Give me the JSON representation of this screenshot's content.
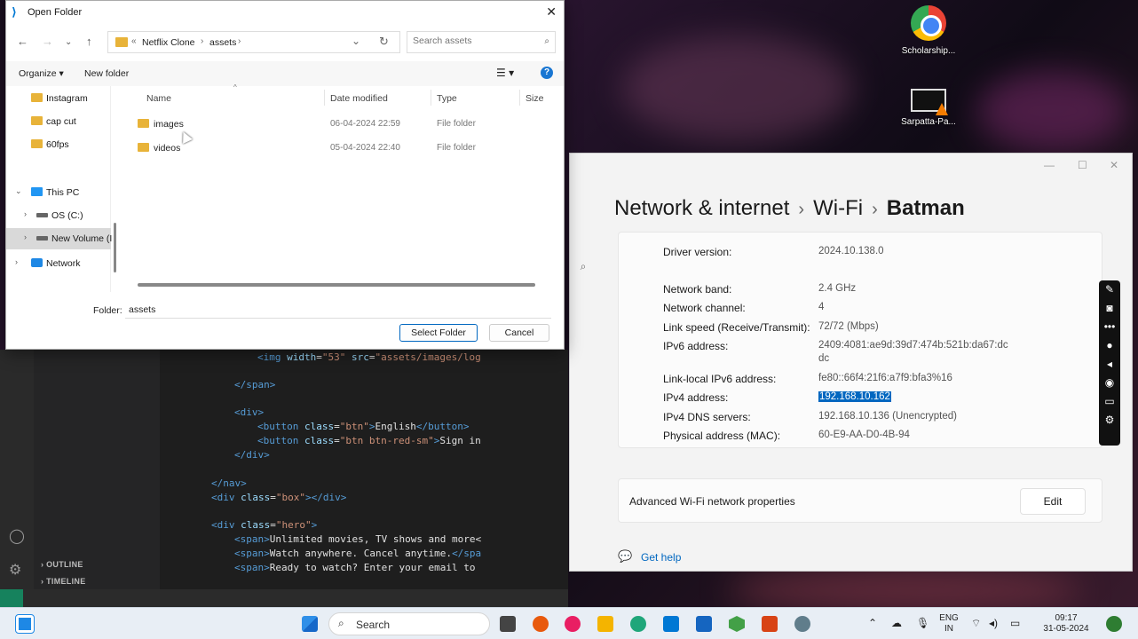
{
  "desktop": {
    "icons": [
      {
        "label": "Scholarship..."
      },
      {
        "label": "Sarpatta-Pa..."
      }
    ]
  },
  "editor": {
    "code_lines": [
      {
        "indent": 4,
        "parts": [
          [
            "tag",
            "<img "
          ],
          [
            "attr",
            "width"
          ],
          [
            "txt",
            "="
          ],
          [
            "str",
            "\"53\""
          ],
          [
            "txt",
            " "
          ],
          [
            "attr",
            "src"
          ],
          [
            "txt",
            "="
          ],
          [
            "str",
            "\"assets/images/log"
          ]
        ]
      },
      {
        "indent": 3,
        "parts": [
          [
            "tag",
            "</span>"
          ]
        ]
      },
      {
        "indent": 3,
        "parts": [
          [
            "tag",
            "<div>"
          ]
        ]
      },
      {
        "indent": 4,
        "parts": [
          [
            "tag",
            "<button "
          ],
          [
            "attr",
            "class"
          ],
          [
            "txt",
            "="
          ],
          [
            "str",
            "\"btn\""
          ],
          [
            "tag",
            ">"
          ],
          [
            "txt",
            "English"
          ],
          [
            "tag",
            "</button>"
          ]
        ]
      },
      {
        "indent": 4,
        "parts": [
          [
            "tag",
            "<button "
          ],
          [
            "attr",
            "class"
          ],
          [
            "txt",
            "="
          ],
          [
            "str",
            "\"btn btn-red-sm\""
          ],
          [
            "tag",
            ">"
          ],
          [
            "txt",
            "Sign in"
          ]
        ]
      },
      {
        "indent": 3,
        "parts": [
          [
            "tag",
            "</div>"
          ]
        ]
      },
      {
        "indent": 2,
        "parts": [
          [
            "tag",
            "</nav>"
          ]
        ]
      },
      {
        "indent": 2,
        "parts": [
          [
            "tag",
            "<div "
          ],
          [
            "attr",
            "class"
          ],
          [
            "txt",
            "="
          ],
          [
            "str",
            "\"box\""
          ],
          [
            "tag",
            "></div>"
          ]
        ]
      },
      {
        "indent": 2,
        "parts": [
          [
            "tag",
            "<div "
          ],
          [
            "attr",
            "class"
          ],
          [
            "txt",
            "="
          ],
          [
            "str",
            "\"hero\""
          ],
          [
            "tag",
            ">"
          ]
        ]
      },
      {
        "indent": 3,
        "parts": [
          [
            "tag",
            "<span>"
          ],
          [
            "txt",
            "Unlimited movies, TV shows and more<"
          ]
        ]
      },
      {
        "indent": 3,
        "parts": [
          [
            "tag",
            "<span>"
          ],
          [
            "txt",
            "Watch anywhere. Cancel anytime."
          ],
          [
            "tag",
            "</spa"
          ]
        ]
      },
      {
        "indent": 3,
        "parts": [
          [
            "tag",
            "<span>"
          ],
          [
            "txt",
            "Ready to watch? Enter your email to"
          ]
        ]
      }
    ],
    "outline_label": "OUTLINE",
    "timeline_label": "TIMELINE"
  },
  "dialog": {
    "title": "Open Folder",
    "breadcrumb": [
      "Netflix Clone",
      "assets"
    ],
    "search_placeholder": "Search assets",
    "organize_label": "Organize ▾",
    "new_folder_label": "New folder",
    "nav_items": [
      {
        "label": "Instagram",
        "kind": "folder"
      },
      {
        "label": "cap cut",
        "kind": "folder"
      },
      {
        "label": "60fps",
        "kind": "folder"
      },
      {
        "label": "This PC",
        "kind": "pc"
      },
      {
        "label": "OS (C:)",
        "kind": "drive"
      },
      {
        "label": "New Volume (I",
        "kind": "drive"
      },
      {
        "label": "Network",
        "kind": "network"
      }
    ],
    "columns": {
      "name": "Name",
      "date": "Date modified",
      "type": "Type",
      "size": "Size"
    },
    "files": [
      {
        "name": "images",
        "date": "06-04-2024 22:59",
        "type": "File folder"
      },
      {
        "name": "videos",
        "date": "05-04-2024 22:40",
        "type": "File folder"
      }
    ],
    "folder_label": "Folder:",
    "folder_value": "assets",
    "select_button": "Select Folder",
    "cancel_button": "Cancel"
  },
  "settings": {
    "breadcrumb": [
      "Network & internet",
      "Wi-Fi",
      "Batman"
    ],
    "properties": [
      {
        "label": "Driver version:",
        "value": "2024.10.138.0"
      },
      {
        "label": "Network band:",
        "value": "2.4 GHz"
      },
      {
        "label": "Network channel:",
        "value": "4"
      },
      {
        "label": "Link speed (Receive/Transmit):",
        "value": "72/72 (Mbps)"
      },
      {
        "label": "IPv6 address:",
        "value": "2409:4081:ae9d:39d7:474b:521b:da67:dc",
        "value2": "dc"
      },
      {
        "label": "Link-local IPv6 address:",
        "value": "fe80::66f4:21f6:a7f9:bfa3%16"
      },
      {
        "label": "IPv4 address:",
        "value": "192.168.10.162",
        "highlight": true
      },
      {
        "label": "IPv4 DNS servers:",
        "value": "192.168.10.136 (Unencrypted)"
      },
      {
        "label": "Physical address (MAC):",
        "value": "60-E9-AA-D0-4B-94"
      }
    ],
    "advanced_label": "Advanced Wi-Fi network properties",
    "edit_label": "Edit",
    "help_label": "Get help"
  },
  "taskbar": {
    "search_label": "Search",
    "lang_top": "ENG",
    "lang_bottom": "IN",
    "time": "09:17",
    "date": "31-05-2024"
  }
}
